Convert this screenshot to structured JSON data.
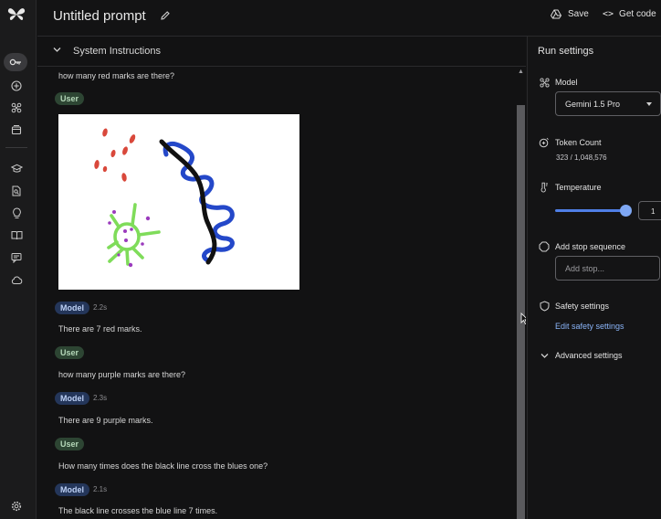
{
  "header": {
    "title": "Untitled prompt",
    "save_label": "Save",
    "get_code_label": "Get code"
  },
  "system_instructions": {
    "label": "System Instructions"
  },
  "conversation": [
    {
      "role": "User",
      "text": "how many red marks are there?",
      "time": ""
    },
    {
      "role": "Model",
      "text": "There are 7 red marks.",
      "time": "2.2s"
    },
    {
      "role": "User",
      "text": "how many purple marks are there?",
      "time": ""
    },
    {
      "role": "Model",
      "text": "There are 9 purple marks.",
      "time": "2.3s"
    },
    {
      "role": "User",
      "text": "How many times does the black line cross the blues one?",
      "time": ""
    },
    {
      "role": "Model",
      "text": "The black line crosses the blue line 7 times.",
      "time": "2.1s"
    }
  ],
  "run_settings": {
    "title": "Run settings",
    "model_label": "Model",
    "model_value": "Gemini 1.5 Pro",
    "token_count_label": "Token Count",
    "token_count_value": "323 / 1,048,576",
    "temperature_label": "Temperature",
    "temperature_value": "1",
    "temperature_fraction": 1.0,
    "stop_sequence_label": "Add stop sequence",
    "stop_sequence_placeholder": "Add stop...",
    "safety_label": "Safety settings",
    "safety_link": "Edit safety settings",
    "advanced_label": "Advanced settings"
  },
  "colors": {
    "background": "#131314",
    "user_chip": "#2d4533",
    "model_chip": "#24365a",
    "accent": "#8ab4f8"
  },
  "icons": {
    "logo": "gemini-spark-icon",
    "rail": [
      "key-icon",
      "add-icon",
      "tuning-icon",
      "library-icon",
      "graduation-cap-icon",
      "document-search-icon",
      "lightbulb-icon",
      "book-icon",
      "chat-icon",
      "cloud-icon",
      "settings-icon"
    ]
  }
}
